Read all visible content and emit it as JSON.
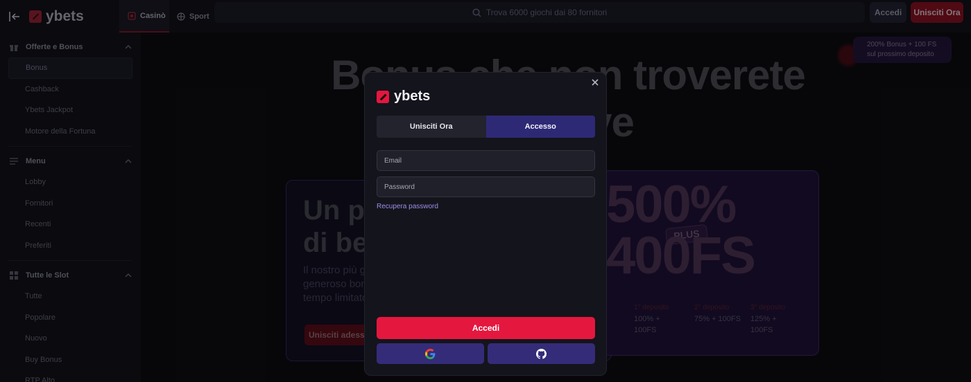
{
  "header": {
    "brand": "ybets",
    "tabs": [
      {
        "label": "Casinò",
        "icon": "casino-icon"
      },
      {
        "label": "Sport",
        "icon": "sport-icon"
      }
    ],
    "search_placeholder": "Trova 6000 giochi dai 80 fornitori",
    "login_label": "Accedi",
    "join_label": "Unisciti Ora"
  },
  "sidebar": {
    "sections": [
      {
        "title": "Offerte e Bonus",
        "icon": "gift-icon",
        "items": [
          "Bonus",
          "Cashback",
          "Ybets Jackpot",
          "Motore della Fortuna"
        ]
      },
      {
        "title": "Menu",
        "icon": "menu-icon",
        "items": [
          "Lobby",
          "Fornitori",
          "Recenti",
          "Preferiti"
        ]
      },
      {
        "title": "Tutte le Slot",
        "icon": "grid-icon",
        "items": [
          "Tutte",
          "Popolare",
          "Nuovo",
          "Buy Bonus",
          "RTP Alto"
        ]
      }
    ],
    "active_item": "Bonus"
  },
  "hero": {
    "title": "Bonus che non troverete altrove",
    "promo_chip": "200% Bonus + 100 FS sul prossimo deposito",
    "card_left": {
      "headline": "Un pacchetto di benvenuto",
      "text": "Il nostro più grande e generoso bonus, per un tempo limitato",
      "cta": "Unisciti adesso"
    },
    "card_right": {
      "percent": "500%",
      "plus": "PLUS",
      "fs": "400FS",
      "tiers": [
        {
          "label": "1° deposito",
          "value": "100% + 100FS"
        },
        {
          "label": "2° deposito",
          "value": "75% + 100FS"
        },
        {
          "label": "3° deposito",
          "value": "125% + 100FS"
        }
      ]
    }
  },
  "modal": {
    "brand": "ybets",
    "tabs": [
      "Unisciti Ora",
      "Accesso"
    ],
    "active_tab": "Accesso",
    "email_placeholder": "Email",
    "password_placeholder": "Password",
    "recover_label": "Recupera password",
    "submit_label": "Accedi",
    "social": [
      "google-icon",
      "github-icon"
    ]
  },
  "colors": {
    "accent_red": "#e4173e",
    "accent_purple": "#2e2975",
    "link": "#9d8fe8"
  }
}
